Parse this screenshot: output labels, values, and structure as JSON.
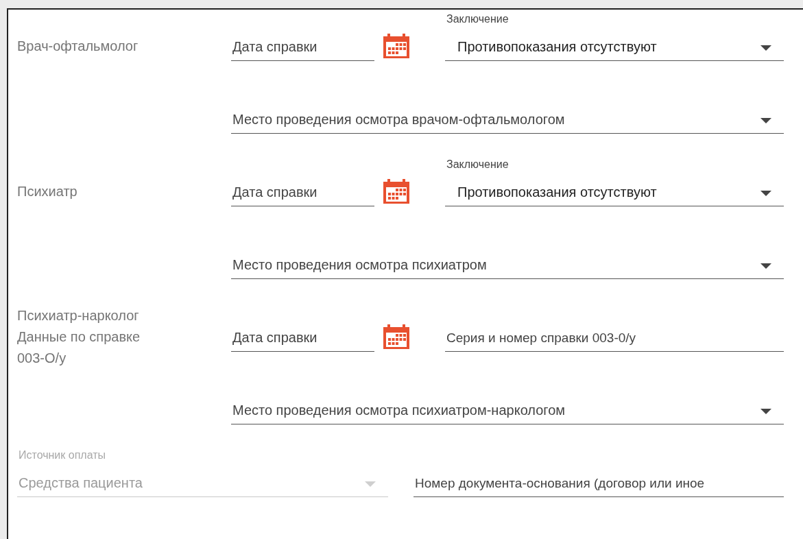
{
  "sections": [
    {
      "label": "Врач-офтальмолог",
      "date": {
        "placeholder": "Дата справки"
      },
      "second": {
        "kind": "select",
        "label": "Заключение",
        "value": "Противопоказания отсутствуют"
      },
      "place": {
        "placeholder": "Место проведения осмотра врачом-офтальмологом"
      }
    },
    {
      "label": "Психиатр",
      "date": {
        "placeholder": "Дата справки"
      },
      "second": {
        "kind": "select",
        "label": "Заключение",
        "value": "Противопоказания отсутствуют"
      },
      "place": {
        "placeholder": "Место проведения осмотра психиатром"
      }
    },
    {
      "label": "Психиатр-нарколог\nДанные по справке\n003-О/у",
      "date": {
        "placeholder": "Дата справки"
      },
      "second": {
        "kind": "text",
        "placeholder": "Серия и номер справки 003-0/у"
      },
      "place": {
        "placeholder": "Место проведения осмотра психиатром-наркологом"
      }
    }
  ],
  "payment": {
    "label": "Источник оплаты",
    "value": "Средства пациента",
    "disabled": true
  },
  "document": {
    "placeholder": "Номер документа-основания (договор или иное"
  }
}
